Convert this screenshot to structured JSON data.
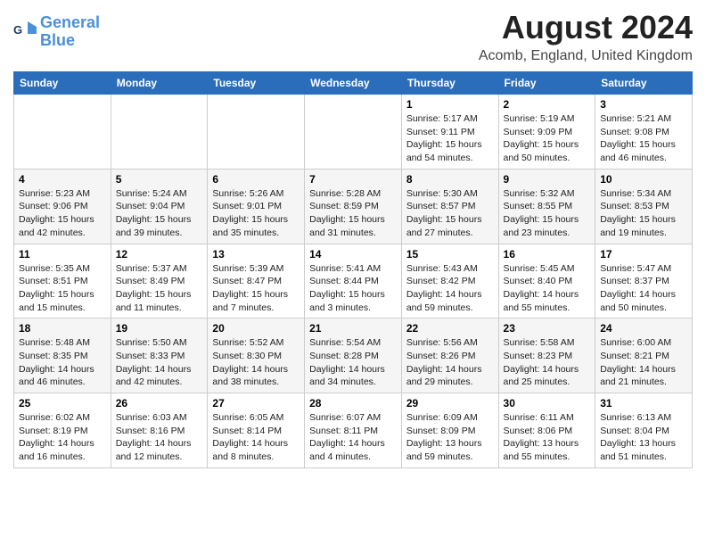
{
  "header": {
    "logo_line1": "General",
    "logo_line2": "Blue",
    "main_title": "August 2024",
    "subtitle": "Acomb, England, United Kingdom"
  },
  "calendar": {
    "days_of_week": [
      "Sunday",
      "Monday",
      "Tuesday",
      "Wednesday",
      "Thursday",
      "Friday",
      "Saturday"
    ],
    "weeks": [
      [
        {
          "day": "",
          "info": ""
        },
        {
          "day": "",
          "info": ""
        },
        {
          "day": "",
          "info": ""
        },
        {
          "day": "",
          "info": ""
        },
        {
          "day": "1",
          "info": "Sunrise: 5:17 AM\nSunset: 9:11 PM\nDaylight: 15 hours\nand 54 minutes."
        },
        {
          "day": "2",
          "info": "Sunrise: 5:19 AM\nSunset: 9:09 PM\nDaylight: 15 hours\nand 50 minutes."
        },
        {
          "day": "3",
          "info": "Sunrise: 5:21 AM\nSunset: 9:08 PM\nDaylight: 15 hours\nand 46 minutes."
        }
      ],
      [
        {
          "day": "4",
          "info": "Sunrise: 5:23 AM\nSunset: 9:06 PM\nDaylight: 15 hours\nand 42 minutes."
        },
        {
          "day": "5",
          "info": "Sunrise: 5:24 AM\nSunset: 9:04 PM\nDaylight: 15 hours\nand 39 minutes."
        },
        {
          "day": "6",
          "info": "Sunrise: 5:26 AM\nSunset: 9:01 PM\nDaylight: 15 hours\nand 35 minutes."
        },
        {
          "day": "7",
          "info": "Sunrise: 5:28 AM\nSunset: 8:59 PM\nDaylight: 15 hours\nand 31 minutes."
        },
        {
          "day": "8",
          "info": "Sunrise: 5:30 AM\nSunset: 8:57 PM\nDaylight: 15 hours\nand 27 minutes."
        },
        {
          "day": "9",
          "info": "Sunrise: 5:32 AM\nSunset: 8:55 PM\nDaylight: 15 hours\nand 23 minutes."
        },
        {
          "day": "10",
          "info": "Sunrise: 5:34 AM\nSunset: 8:53 PM\nDaylight: 15 hours\nand 19 minutes."
        }
      ],
      [
        {
          "day": "11",
          "info": "Sunrise: 5:35 AM\nSunset: 8:51 PM\nDaylight: 15 hours\nand 15 minutes."
        },
        {
          "day": "12",
          "info": "Sunrise: 5:37 AM\nSunset: 8:49 PM\nDaylight: 15 hours\nand 11 minutes."
        },
        {
          "day": "13",
          "info": "Sunrise: 5:39 AM\nSunset: 8:47 PM\nDaylight: 15 hours\nand 7 minutes."
        },
        {
          "day": "14",
          "info": "Sunrise: 5:41 AM\nSunset: 8:44 PM\nDaylight: 15 hours\nand 3 minutes."
        },
        {
          "day": "15",
          "info": "Sunrise: 5:43 AM\nSunset: 8:42 PM\nDaylight: 14 hours\nand 59 minutes."
        },
        {
          "day": "16",
          "info": "Sunrise: 5:45 AM\nSunset: 8:40 PM\nDaylight: 14 hours\nand 55 minutes."
        },
        {
          "day": "17",
          "info": "Sunrise: 5:47 AM\nSunset: 8:37 PM\nDaylight: 14 hours\nand 50 minutes."
        }
      ],
      [
        {
          "day": "18",
          "info": "Sunrise: 5:48 AM\nSunset: 8:35 PM\nDaylight: 14 hours\nand 46 minutes."
        },
        {
          "day": "19",
          "info": "Sunrise: 5:50 AM\nSunset: 8:33 PM\nDaylight: 14 hours\nand 42 minutes."
        },
        {
          "day": "20",
          "info": "Sunrise: 5:52 AM\nSunset: 8:30 PM\nDaylight: 14 hours\nand 38 minutes."
        },
        {
          "day": "21",
          "info": "Sunrise: 5:54 AM\nSunset: 8:28 PM\nDaylight: 14 hours\nand 34 minutes."
        },
        {
          "day": "22",
          "info": "Sunrise: 5:56 AM\nSunset: 8:26 PM\nDaylight: 14 hours\nand 29 minutes."
        },
        {
          "day": "23",
          "info": "Sunrise: 5:58 AM\nSunset: 8:23 PM\nDaylight: 14 hours\nand 25 minutes."
        },
        {
          "day": "24",
          "info": "Sunrise: 6:00 AM\nSunset: 8:21 PM\nDaylight: 14 hours\nand 21 minutes."
        }
      ],
      [
        {
          "day": "25",
          "info": "Sunrise: 6:02 AM\nSunset: 8:19 PM\nDaylight: 14 hours\nand 16 minutes."
        },
        {
          "day": "26",
          "info": "Sunrise: 6:03 AM\nSunset: 8:16 PM\nDaylight: 14 hours\nand 12 minutes."
        },
        {
          "day": "27",
          "info": "Sunrise: 6:05 AM\nSunset: 8:14 PM\nDaylight: 14 hours\nand 8 minutes."
        },
        {
          "day": "28",
          "info": "Sunrise: 6:07 AM\nSunset: 8:11 PM\nDaylight: 14 hours\nand 4 minutes."
        },
        {
          "day": "29",
          "info": "Sunrise: 6:09 AM\nSunset: 8:09 PM\nDaylight: 13 hours\nand 59 minutes."
        },
        {
          "day": "30",
          "info": "Sunrise: 6:11 AM\nSunset: 8:06 PM\nDaylight: 13 hours\nand 55 minutes."
        },
        {
          "day": "31",
          "info": "Sunrise: 6:13 AM\nSunset: 8:04 PM\nDaylight: 13 hours\nand 51 minutes."
        }
      ]
    ]
  }
}
